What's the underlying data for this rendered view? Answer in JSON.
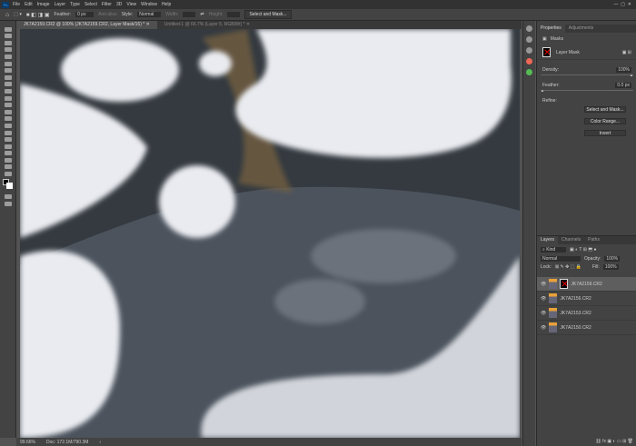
{
  "menu": [
    "File",
    "Edit",
    "Image",
    "Layer",
    "Type",
    "Select",
    "Filter",
    "3D",
    "View",
    "Window",
    "Help"
  ],
  "app_logo": "Ps",
  "options": {
    "feather_label": "Feather:",
    "feather_value": "0 px",
    "antialias": "Anti-alias",
    "style_label": "Style:",
    "style_value": "Normal",
    "width_label": "Width:",
    "height_label": "Height:",
    "select_mask": "Select and Mask..."
  },
  "tabs": [
    "JK7A2159.CR2 @ 100% (JK7A2159.CR2, Layer Mask/16) *",
    "Untitled-1 @ 66.7% (Layer 5, RGB/8#) *"
  ],
  "status": {
    "zoom": "99.66%",
    "doc": "Doc: 172.1M/790.3M"
  },
  "properties": {
    "tabs": [
      "Properties",
      "Adjustments"
    ],
    "section": "Masks",
    "mask_label": "Layer Mask",
    "density_label": "Density:",
    "density_value": "100%",
    "density": 100,
    "feather_label": "Feather:",
    "feather_value": "0.0 px",
    "refine_label": "Refine:",
    "buttons": [
      "Select and Mask...",
      "Color Range...",
      "Invert"
    ]
  },
  "layers": {
    "tabs": [
      "Layers",
      "Channels",
      "Paths"
    ],
    "filter": "Kind",
    "blend": "Normal",
    "opacity_label": "Opacity:",
    "opacity": "100%",
    "lock_label": "Lock:",
    "fill_label": "Fill:",
    "fill": "100%",
    "items": [
      {
        "name": "JK7A2159.CR2",
        "selected": true,
        "mask": true
      },
      {
        "name": "JK7A2156.CR2"
      },
      {
        "name": "JK7A2153.CR2"
      },
      {
        "name": "JK7A2150.CR2"
      }
    ]
  },
  "colors": {
    "accent": "#31a8ff",
    "mask_x": "#e00000"
  }
}
